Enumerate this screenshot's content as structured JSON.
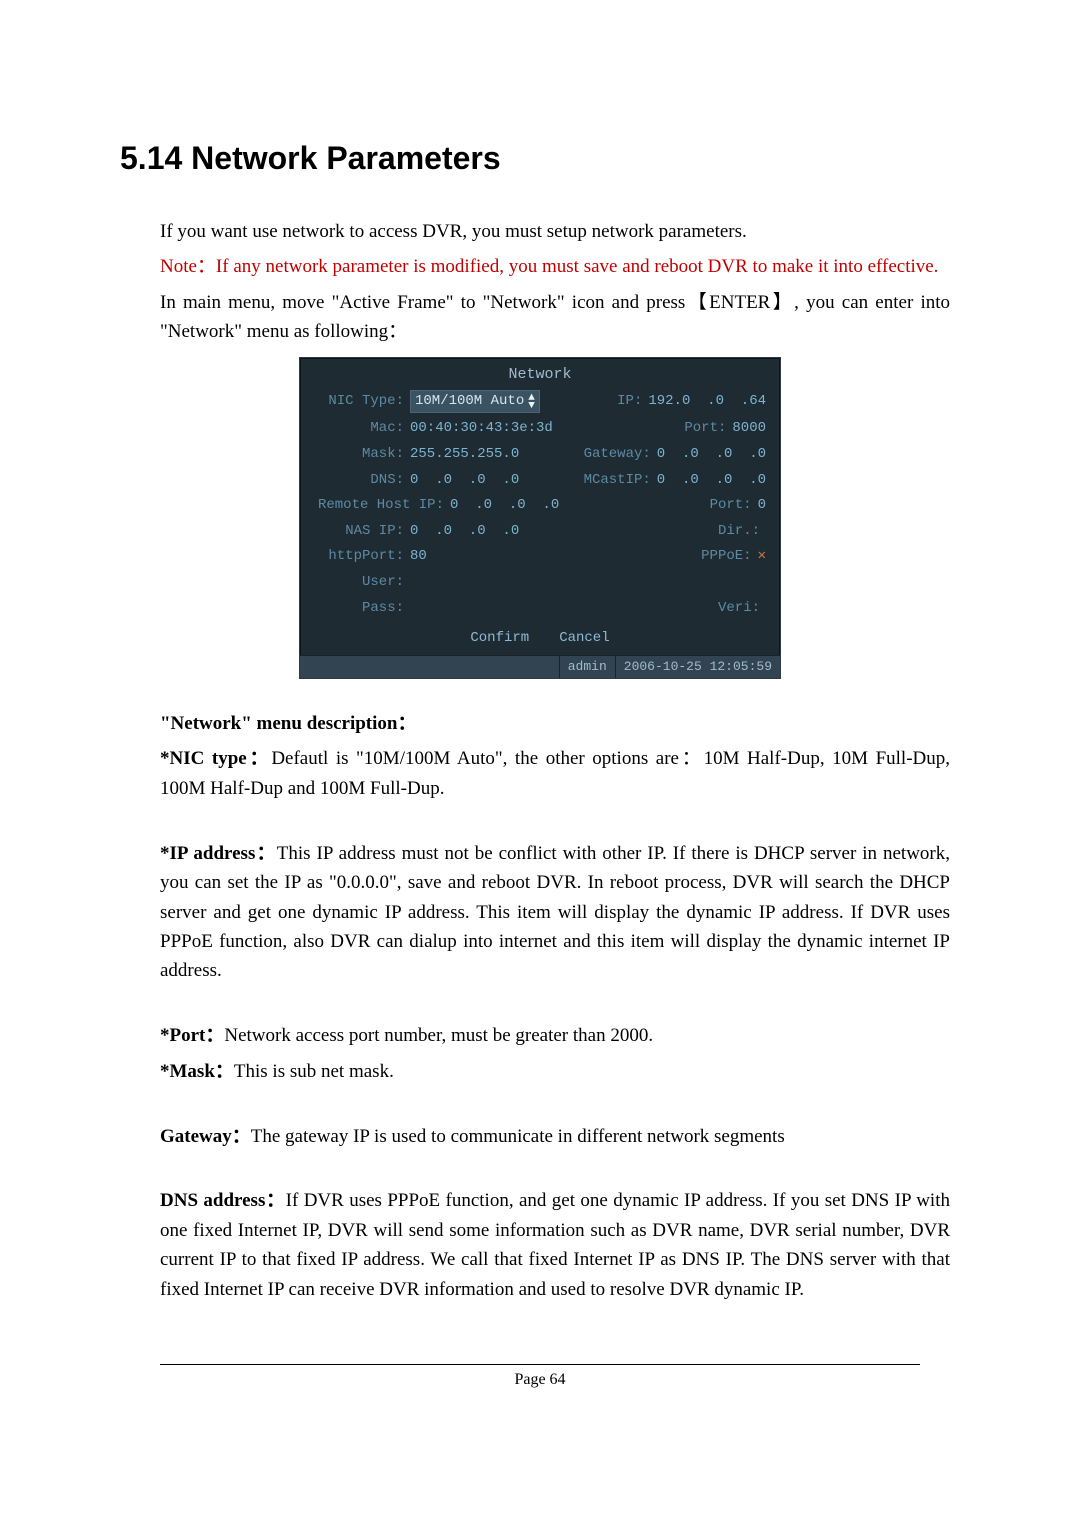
{
  "heading": "5.14  Network Parameters",
  "intro": {
    "p1": "If you want use network to access DVR, you must setup network parameters.",
    "note": "Note：If any network parameter is modified, you must save and reboot DVR to make it into effective.",
    "p2": "In main menu, move \"Active Frame\" to \"Network\" icon and press【ENTER】, you can enter into \"Network\" menu as following："
  },
  "dvr": {
    "title": "Network",
    "nic_label": "NIC Type:",
    "nic_value": "10M/100M Auto",
    "ip_label": "IP:",
    "ip_value": "192.0  .0  .64",
    "mac_label": "Mac:",
    "mac_value": "00:40:30:43:3e:3d",
    "port_label": "Port:",
    "port_value": "8000",
    "mask_label": "Mask:",
    "mask_value": "255.255.255.0",
    "gateway_label": "Gateway:",
    "gateway_value": "0  .0  .0  .0",
    "dns_label": "DNS:",
    "dns_value": "0  .0  .0  .0",
    "mcast_label": "MCastIP:",
    "mcast_value": "0  .0  .0  .0",
    "remote_label": "Remote Host IP:",
    "remote_value": "0  .0  .0  .0",
    "remote_port_label": "Port:",
    "remote_port_value": "0",
    "nas_label": "NAS IP:",
    "nas_value": "0  .0  .0  .0",
    "dir_label": "Dir.:",
    "http_label": "httpPort:",
    "http_value": "80",
    "pppoe_label": "PPPoE:",
    "pppoe_mark": "✕",
    "user_label": "User:",
    "pass_label": "Pass:",
    "veri_label": "Veri:",
    "confirm": "Confirm",
    "cancel": "Cancel",
    "status_user": "admin",
    "status_time": "2006-10-25 12:05:59"
  },
  "desc": {
    "heading": "\"Network\" menu description：",
    "nic_label": "*NIC type：",
    "nic_text": "Defautl is \"10M/100M Auto\", the other options are：10M Half-Dup, 10M Full-Dup, 100M Half-Dup and 100M Full-Dup.",
    "ip_label": "*IP address：",
    "ip_text": "This IP address must not be conflict with other IP. If there is DHCP server in network, you can set the IP as \"0.0.0.0\", save and reboot DVR. In reboot process, DVR will search the DHCP server and get one dynamic IP address. This item will display the dynamic IP address. If DVR uses PPPoE function, also DVR can dialup into internet and this item will display the dynamic internet IP address.",
    "port_label": "*Port：",
    "port_text": "Network access port number, must be greater than 2000.",
    "mask_label": "*Mask：",
    "mask_text": "This is sub net mask.",
    "gw_label": "Gateway：",
    "gw_text": "The gateway IP is used to communicate in different network segments",
    "dns_label": "DNS address：",
    "dns_text": "If DVR uses PPPoE function, and get one dynamic IP address. If you set DNS IP with one fixed Internet IP, DVR will send some information such as DVR name, DVR serial number, DVR current IP to that fixed IP address. We call that fixed Internet IP as DNS IP. The DNS server with that fixed Internet IP can receive DVR information and used to resolve DVR dynamic IP."
  },
  "footer": "Page 64"
}
